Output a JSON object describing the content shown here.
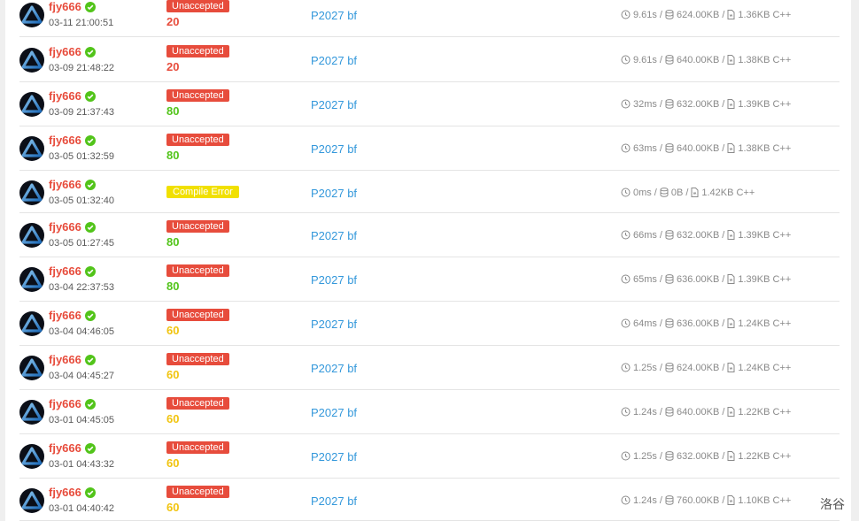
{
  "records": [
    {
      "user": "fjy666",
      "time": "03-11 21:00:51",
      "status": "Unaccepted",
      "score": "20",
      "problem": "P2027 bf",
      "runtime": "9.61s",
      "memory": "624.00KB",
      "size": "1.36KB",
      "lang": "C++"
    },
    {
      "user": "fjy666",
      "time": "03-09 21:48:22",
      "status": "Unaccepted",
      "score": "20",
      "problem": "P2027 bf",
      "runtime": "9.61s",
      "memory": "640.00KB",
      "size": "1.38KB",
      "lang": "C++"
    },
    {
      "user": "fjy666",
      "time": "03-09 21:37:43",
      "status": "Unaccepted",
      "score": "80",
      "problem": "P2027 bf",
      "runtime": "32ms",
      "memory": "632.00KB",
      "size": "1.39KB",
      "lang": "C++"
    },
    {
      "user": "fjy666",
      "time": "03-05 01:32:59",
      "status": "Unaccepted",
      "score": "80",
      "problem": "P2027 bf",
      "runtime": "63ms",
      "memory": "640.00KB",
      "size": "1.38KB",
      "lang": "C++"
    },
    {
      "user": "fjy666",
      "time": "03-05 01:32:40",
      "status": "Compile Error",
      "score": "",
      "problem": "P2027 bf",
      "runtime": "0ms",
      "memory": "0B",
      "size": "1.42KB",
      "lang": "C++"
    },
    {
      "user": "fjy666",
      "time": "03-05 01:27:45",
      "status": "Unaccepted",
      "score": "80",
      "problem": "P2027 bf",
      "runtime": "66ms",
      "memory": "632.00KB",
      "size": "1.39KB",
      "lang": "C++"
    },
    {
      "user": "fjy666",
      "time": "03-04 22:37:53",
      "status": "Unaccepted",
      "score": "80",
      "problem": "P2027 bf",
      "runtime": "65ms",
      "memory": "636.00KB",
      "size": "1.39KB",
      "lang": "C++"
    },
    {
      "user": "fjy666",
      "time": "03-04 04:46:05",
      "status": "Unaccepted",
      "score": "60",
      "problem": "P2027 bf",
      "runtime": "64ms",
      "memory": "636.00KB",
      "size": "1.24KB",
      "lang": "C++"
    },
    {
      "user": "fjy666",
      "time": "03-04 04:45:27",
      "status": "Unaccepted",
      "score": "60",
      "problem": "P2027 bf",
      "runtime": "1.25s",
      "memory": "624.00KB",
      "size": "1.24KB",
      "lang": "C++"
    },
    {
      "user": "fjy666",
      "time": "03-01 04:45:05",
      "status": "Unaccepted",
      "score": "60",
      "problem": "P2027 bf",
      "runtime": "1.24s",
      "memory": "640.00KB",
      "size": "1.22KB",
      "lang": "C++"
    },
    {
      "user": "fjy666",
      "time": "03-01 04:43:32",
      "status": "Unaccepted",
      "score": "60",
      "problem": "P2027 bf",
      "runtime": "1.25s",
      "memory": "632.00KB",
      "size": "1.22KB",
      "lang": "C++"
    },
    {
      "user": "fjy666",
      "time": "03-01 04:40:42",
      "status": "Unaccepted",
      "score": "60",
      "problem": "P2027 bf",
      "runtime": "1.24s",
      "memory": "760.00KB",
      "size": "1.10KB",
      "lang": "C++"
    }
  ],
  "colors": {
    "unaccepted": "#e74c3c",
    "compile_error": "#f1e000",
    "score_low": "#e74c3c",
    "score_mid": "#f1c40f",
    "score_high": "#52c41a",
    "link": "#3498db",
    "verified": "#52c41a"
  },
  "icons": {
    "verified": "check-circle-icon",
    "runtime": "clock-icon",
    "memory": "database-icon",
    "size": "file-icon"
  },
  "brand": "洛谷"
}
